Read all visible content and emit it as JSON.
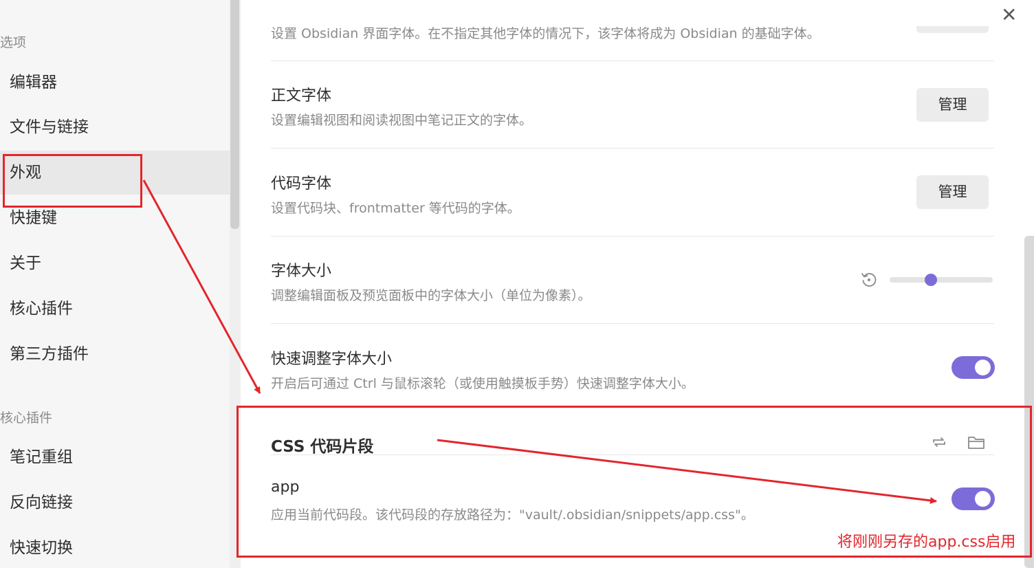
{
  "sidebar": {
    "section_options": "选项",
    "options_items": [
      "编辑器",
      "文件与链接",
      "外观",
      "快捷键",
      "关于",
      "核心插件",
      "第三方插件"
    ],
    "section_core": "核心插件",
    "core_items": [
      "笔记重组",
      "反向链接",
      "快速切换"
    ]
  },
  "main": {
    "close_symbol": "✕",
    "top_desc": "设置 Obsidian 界面字体。在不指定其他字体的情况下，该字体将成为 Obsidian 的基础字体。",
    "body_font": {
      "name": "正文字体",
      "desc": "设置编辑视图和阅读视图中笔记正文的字体。",
      "button": "管理"
    },
    "code_font": {
      "name": "代码字体",
      "desc": "设置代码块、frontmatter 等代码的字体。",
      "button": "管理"
    },
    "font_size": {
      "name": "字体大小",
      "desc": "调整编辑面板及预览面板中的字体大小（单位为像素）。",
      "slider_fraction": 0.4
    },
    "quick_font": {
      "name": "快速调整字体大小",
      "desc": "开启后可通过 Ctrl 与鼠标滚轮（或使用触摸板手势）快速调整字体大小。",
      "enabled": true
    },
    "css_snippets": {
      "heading": "CSS 代码片段",
      "reload_icon": "reload-icon",
      "folder_icon": "folder-icon",
      "snippet": {
        "name": "app",
        "desc": "应用当前代码段。该代码段的存放路径为：\"vault/.obsidian/snippets/app.css\"。",
        "enabled": true
      }
    }
  },
  "annotation": {
    "text": "将刚刚另存的app.css启用",
    "color": "#e3252c"
  },
  "colors": {
    "accent": "#7b6cd9"
  }
}
